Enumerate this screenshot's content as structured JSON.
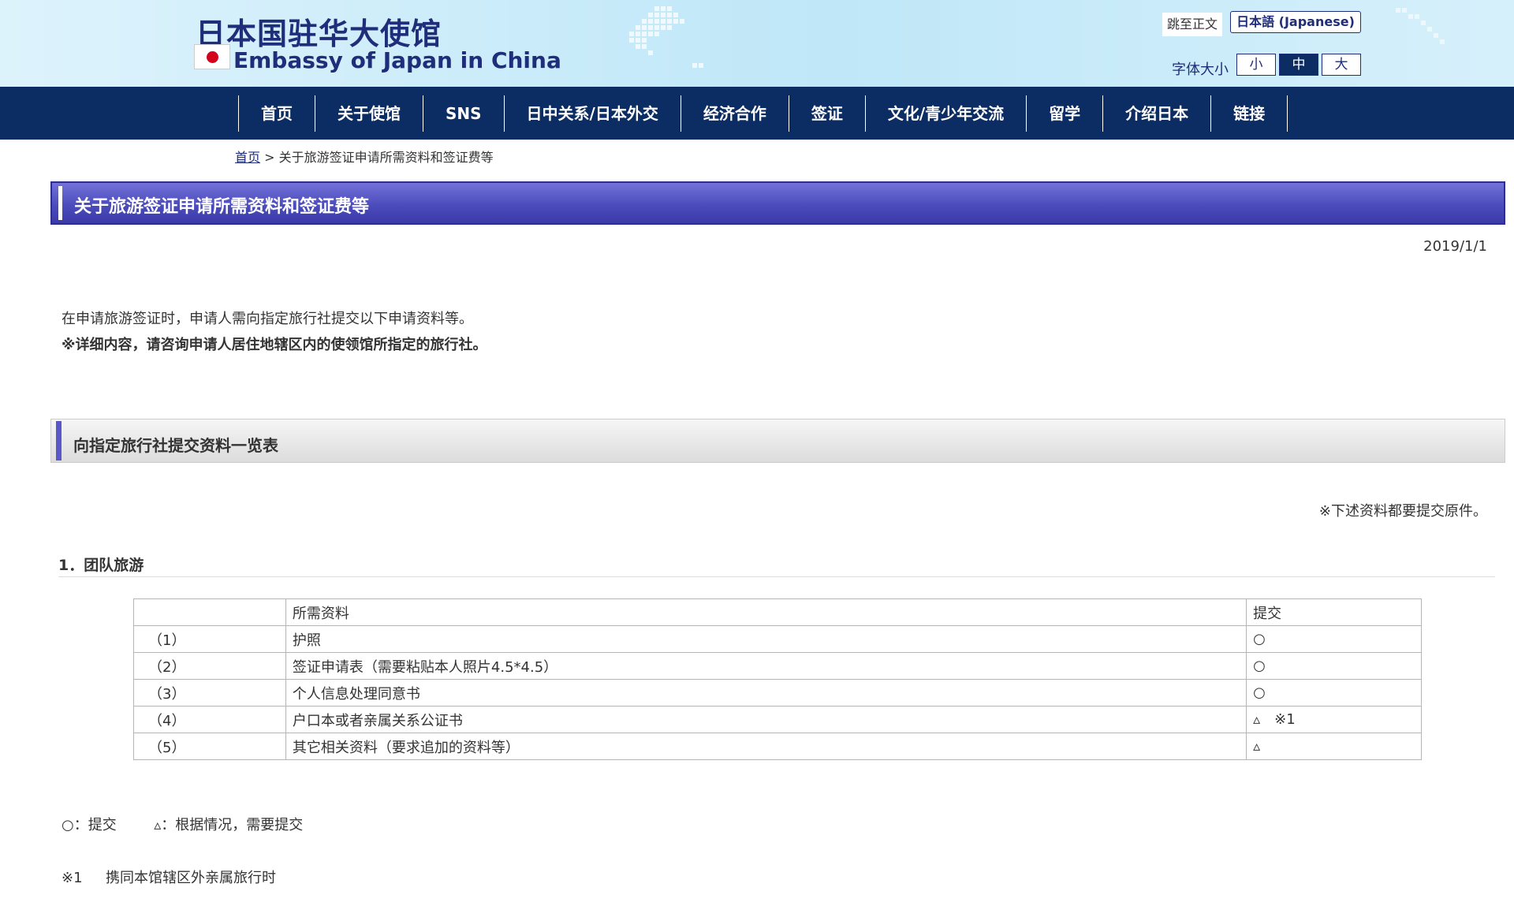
{
  "header": {
    "title_jp": "日本国驻华大使馆",
    "title_en": "Embassy of Japan in China",
    "skip_link": "跳至正文",
    "lang_button": "日本語 (Japanese)",
    "font_size_label": "字体大小",
    "font_sizes": [
      "小",
      "中",
      "大"
    ],
    "selected_font_size": "中"
  },
  "nav": {
    "items": [
      "首页",
      "关于使馆",
      "SNS",
      "日中关系/日本外交",
      "经济合作",
      "签证",
      "文化/青少年交流",
      "留学",
      "介绍日本",
      "链接"
    ]
  },
  "breadcrumb": {
    "home": "首页",
    "separator": ">",
    "current": "关于旅游签证申请所需资料和签证费等"
  },
  "page": {
    "title": "关于旅游签证申请所需资料和签证费等",
    "date": "2019/1/1",
    "intro_line1": "在申请旅游签证时，申请人需向指定旅行社提交以下申请资料等。",
    "intro_line2": "※详细内容，请咨询申请人居住地辖区内的使领馆所指定的旅行社。"
  },
  "section": {
    "title": "向指定旅行社提交资料一览表",
    "note": "※下述资料都要提交原件。",
    "subsection_title": "1．团队旅游"
  },
  "table": {
    "headers": [
      "",
      "所需资料",
      "提交"
    ],
    "rows": [
      {
        "num": "（1）",
        "item": "护照",
        "mark": "○",
        "note": ""
      },
      {
        "num": "（2）",
        "item": "签证申请表（需要粘贴本人照片4.5*4.5）",
        "mark": "○",
        "note": ""
      },
      {
        "num": "（3）",
        "item": "个人信息处理同意书",
        "mark": "○",
        "note": ""
      },
      {
        "num": "（4）",
        "item": "户口本或者亲属关系公证书",
        "mark": "▵",
        "note": "※1"
      },
      {
        "num": "（5）",
        "item": "其它相关资料（要求追加的资料等）",
        "mark": "▵",
        "note": ""
      }
    ]
  },
  "legend": {
    "submit": "○：提交",
    "conditional": "▵：根据情况，需要提交"
  },
  "footnote": {
    "mark": "※1",
    "text": "携同本馆辖区外亲属旅行时"
  },
  "colors": {
    "navy": "#0c2d63",
    "title_blue": "#1f2d7a",
    "title_bar_purple": "#4c4cbd",
    "section_accent": "#5a58c8"
  }
}
